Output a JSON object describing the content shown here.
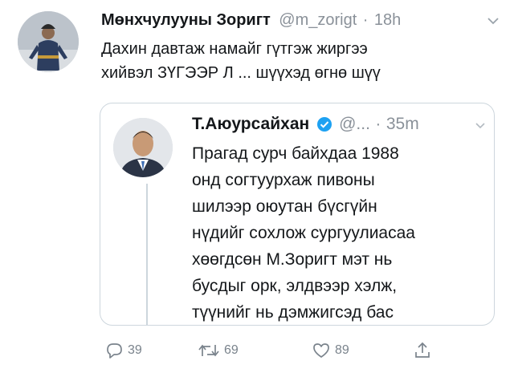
{
  "tweet": {
    "author_name": "Мөнхчулууны Зоригт",
    "author_handle": "@m_zorigt",
    "separator": "·",
    "time": "18h",
    "text_lines": [
      "Дахин давтаж намайг гүтгэж жиргээ",
      "хийвэл ЗҮГЭЭР Л ... шүүхэд өгнө шүү"
    ],
    "avatar_icon": "person-in-traditional-deel-icon"
  },
  "quote": {
    "author_name": "Т.Аюурсайхан",
    "verified_icon": "verified-badge-icon",
    "author_handle": "@...",
    "separator": "·",
    "time": "35m",
    "text_lines": [
      "Прагад сурч байхдаа 1988",
      "онд согтуурхаж пивоны",
      "шилээр оюутан бүсгүйн",
      "нүдийг сохлож сургуулиасаа",
      "хөөгдсөн М.Зоригт мэт нь",
      "бусдыг орк, элдвээр хэлж,",
      "түүнийг нь дэмжигсэд бас"
    ],
    "avatar_icon": "person-in-suit-icon"
  },
  "actions": {
    "reply_count": "39",
    "retweet_count": "69",
    "like_count": "89",
    "icons": [
      "reply-icon",
      "retweet-icon",
      "like-icon",
      "share-icon"
    ]
  },
  "colors": {
    "text": "#14171a",
    "secondary": "#8a9199",
    "verified": "#1da1f2",
    "border": "#cdd6dd"
  }
}
